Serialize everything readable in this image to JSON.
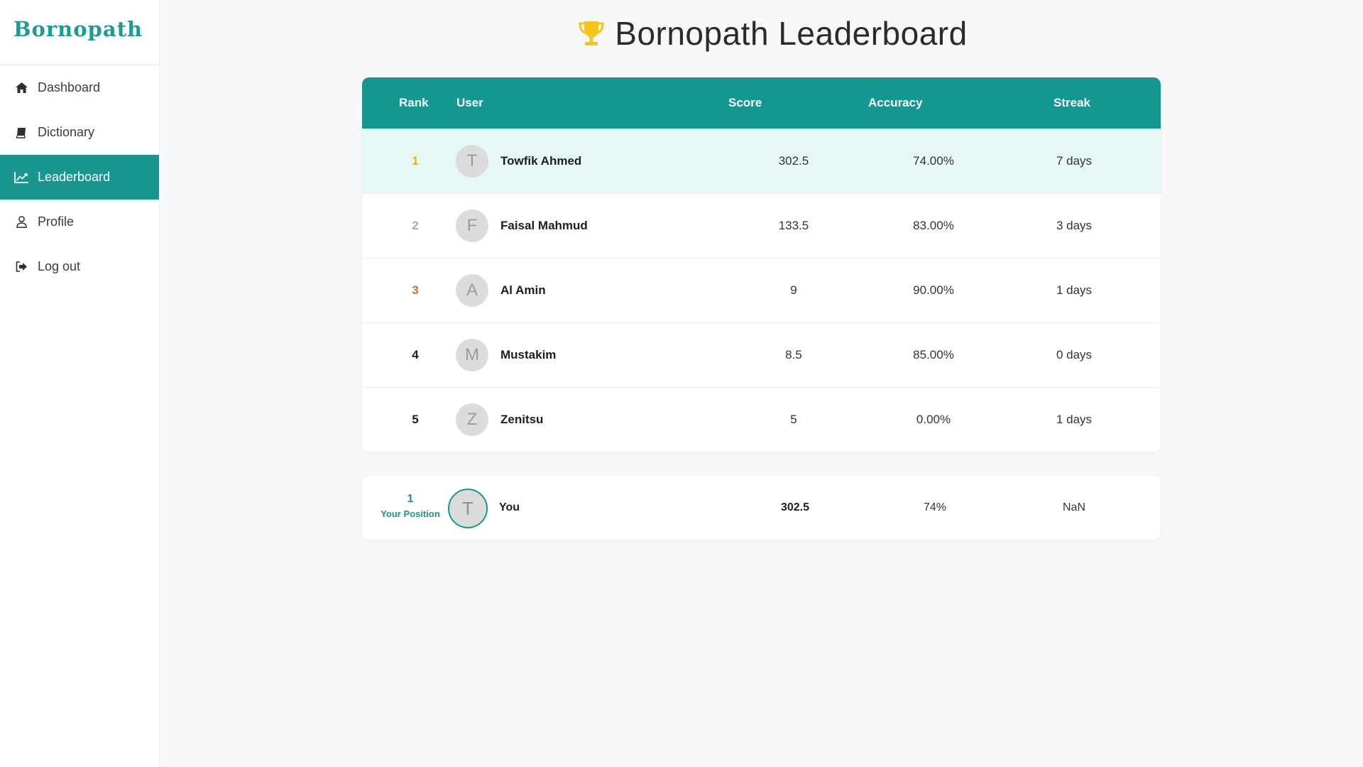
{
  "brand": {
    "name": "Bornopath"
  },
  "sidebar": {
    "items": [
      {
        "label": "Dashboard",
        "icon": "home-icon"
      },
      {
        "label": "Dictionary",
        "icon": "book-icon"
      },
      {
        "label": "Leaderboard",
        "icon": "chart-line-icon",
        "active": true
      },
      {
        "label": "Profile",
        "icon": "user-icon"
      },
      {
        "label": "Log out",
        "icon": "logout-icon"
      }
    ]
  },
  "page": {
    "title": "Bornopath Leaderboard",
    "title_icon": "trophy-icon"
  },
  "table": {
    "headers": {
      "rank": "Rank",
      "user": "User",
      "score": "Score",
      "accuracy": "Accuracy",
      "streak": "Streak"
    },
    "rows": [
      {
        "rank": "1",
        "initial": "T",
        "name": "Towfik Ahmed",
        "score": "302.5",
        "accuracy": "74.00%",
        "streak": "7 days"
      },
      {
        "rank": "2",
        "initial": "F",
        "name": "Faisal Mahmud",
        "score": "133.5",
        "accuracy": "83.00%",
        "streak": "3 days"
      },
      {
        "rank": "3",
        "initial": "A",
        "name": "Al Amin",
        "score": "9",
        "accuracy": "90.00%",
        "streak": "1 days"
      },
      {
        "rank": "4",
        "initial": "M",
        "name": "Mustakim",
        "score": "8.5",
        "accuracy": "85.00%",
        "streak": "0 days"
      },
      {
        "rank": "5",
        "initial": "Z",
        "name": "Zenitsu",
        "score": "5",
        "accuracy": "0.00%",
        "streak": "1 days"
      }
    ]
  },
  "your_position": {
    "rank": "1",
    "label": "Your Position",
    "initial": "T",
    "name": "You",
    "score": "302.5",
    "accuracy": "74%",
    "streak": "NaN"
  },
  "colors": {
    "accent": "#159791",
    "highlight_row": "#e6f7f6",
    "rank_gold": "#f0b400",
    "rank_silver": "#a9a9a9",
    "rank_bronze": "#c8742b"
  }
}
